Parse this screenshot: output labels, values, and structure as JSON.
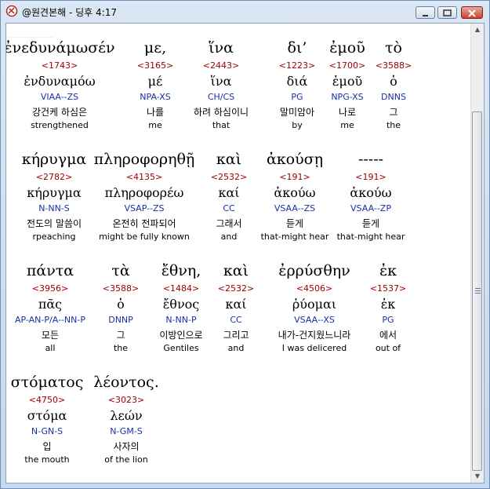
{
  "window": {
    "title": "@원견본해 - 딩후 4:17",
    "icon": "app-icon"
  },
  "rows": [
    [
      {
        "greek": "ἐνεδυνάμωσέν",
        "strong": "<1743>",
        "lemma": "ἐνδυναμόω",
        "morph": "VIAA--ZS",
        "korean": "강건케 하심은",
        "english": "strengthened"
      },
      {
        "greek": "με,",
        "strong": "<3165>",
        "lemma": "μέ",
        "morph": "NPA-XS",
        "korean": "나를",
        "english": "me"
      },
      {
        "greek": "ἵνα",
        "strong": "<2443>",
        "lemma": "ἵνα",
        "morph": "CH/CS",
        "korean": "하려 하심이니",
        "english": "that"
      },
      {
        "greek": "δι’",
        "strong": "<1223>",
        "lemma": "διά",
        "morph": "PG",
        "korean": "말미암아",
        "english": "by"
      },
      {
        "greek": "ἐμοῦ",
        "strong": "<1700>",
        "lemma": "ἐμοῦ",
        "morph": "NPG-XS",
        "korean": "나로",
        "english": "me"
      },
      {
        "greek": "τὸ",
        "strong": "<3588>",
        "lemma": "ὁ",
        "morph": "DNNS",
        "korean": "그",
        "english": "the"
      }
    ],
    [
      {
        "greek": "κήρυγμα",
        "strong": "<2782>",
        "lemma": "κήρυγμα",
        "morph": "N-NN-S",
        "korean": "전도의 말씀이",
        "english": "rpeaching"
      },
      {
        "greek": "πληροφορηθῇ",
        "strong": "<4135>",
        "lemma": "πληροφορέω",
        "morph": "VSAP--ZS",
        "korean": "온전히 전파되어",
        "english": "might be fully known"
      },
      {
        "greek": "καὶ",
        "strong": "<2532>",
        "lemma": "καί",
        "morph": "CC",
        "korean": "그래서",
        "english": "and"
      },
      {
        "greek": "ἀκούσῃ",
        "strong": "<191>",
        "lemma": "ἀκούω",
        "morph": "VSAA--ZS",
        "korean": "듣게",
        "english": "that-might hear"
      },
      {
        "greek": "-----",
        "strong": "<191>",
        "lemma": "ἀκούω",
        "morph": "VSAA--ZP",
        "korean": "듣게",
        "english": "that-might hear"
      }
    ],
    [
      {
        "greek": "πάντα",
        "strong": "<3956>",
        "lemma": "πᾶς",
        "morph": "AP-AN-P/A--NN-P",
        "korean": "모든",
        "english": "all"
      },
      {
        "greek": "τὰ",
        "strong": "<3588>",
        "lemma": "ὁ",
        "morph": "DNNP",
        "korean": "그",
        "english": "the"
      },
      {
        "greek": "ἔθνη,",
        "strong": "<1484>",
        "lemma": "ἔθνος",
        "morph": "N-NN-P",
        "korean": "이방인으로",
        "english": "Gentiles"
      },
      {
        "greek": "καὶ",
        "strong": "<2532>",
        "lemma": "καί",
        "morph": "CC",
        "korean": "그리고",
        "english": "and"
      },
      {
        "greek": "ἐρρύσθην",
        "strong": "<4506>",
        "lemma": "ῥύομαι",
        "morph": "VSAA--XS",
        "korean": "내가-건지웠느니라",
        "english": "I was delicered"
      },
      {
        "greek": "ἐκ",
        "strong": "<1537>",
        "lemma": "ἐκ",
        "morph": "PG",
        "korean": "에서",
        "english": "out of"
      }
    ],
    [
      {
        "greek": "στόματος",
        "strong": "<4750>",
        "lemma": "στόμα",
        "morph": "N-GN-S",
        "korean": "입",
        "english": "the mouth"
      },
      {
        "greek": "λέοντος.",
        "strong": "<3023>",
        "lemma": "λεών",
        "morph": "N-GM-S",
        "korean": "사자의",
        "english": "of the lion"
      }
    ]
  ]
}
